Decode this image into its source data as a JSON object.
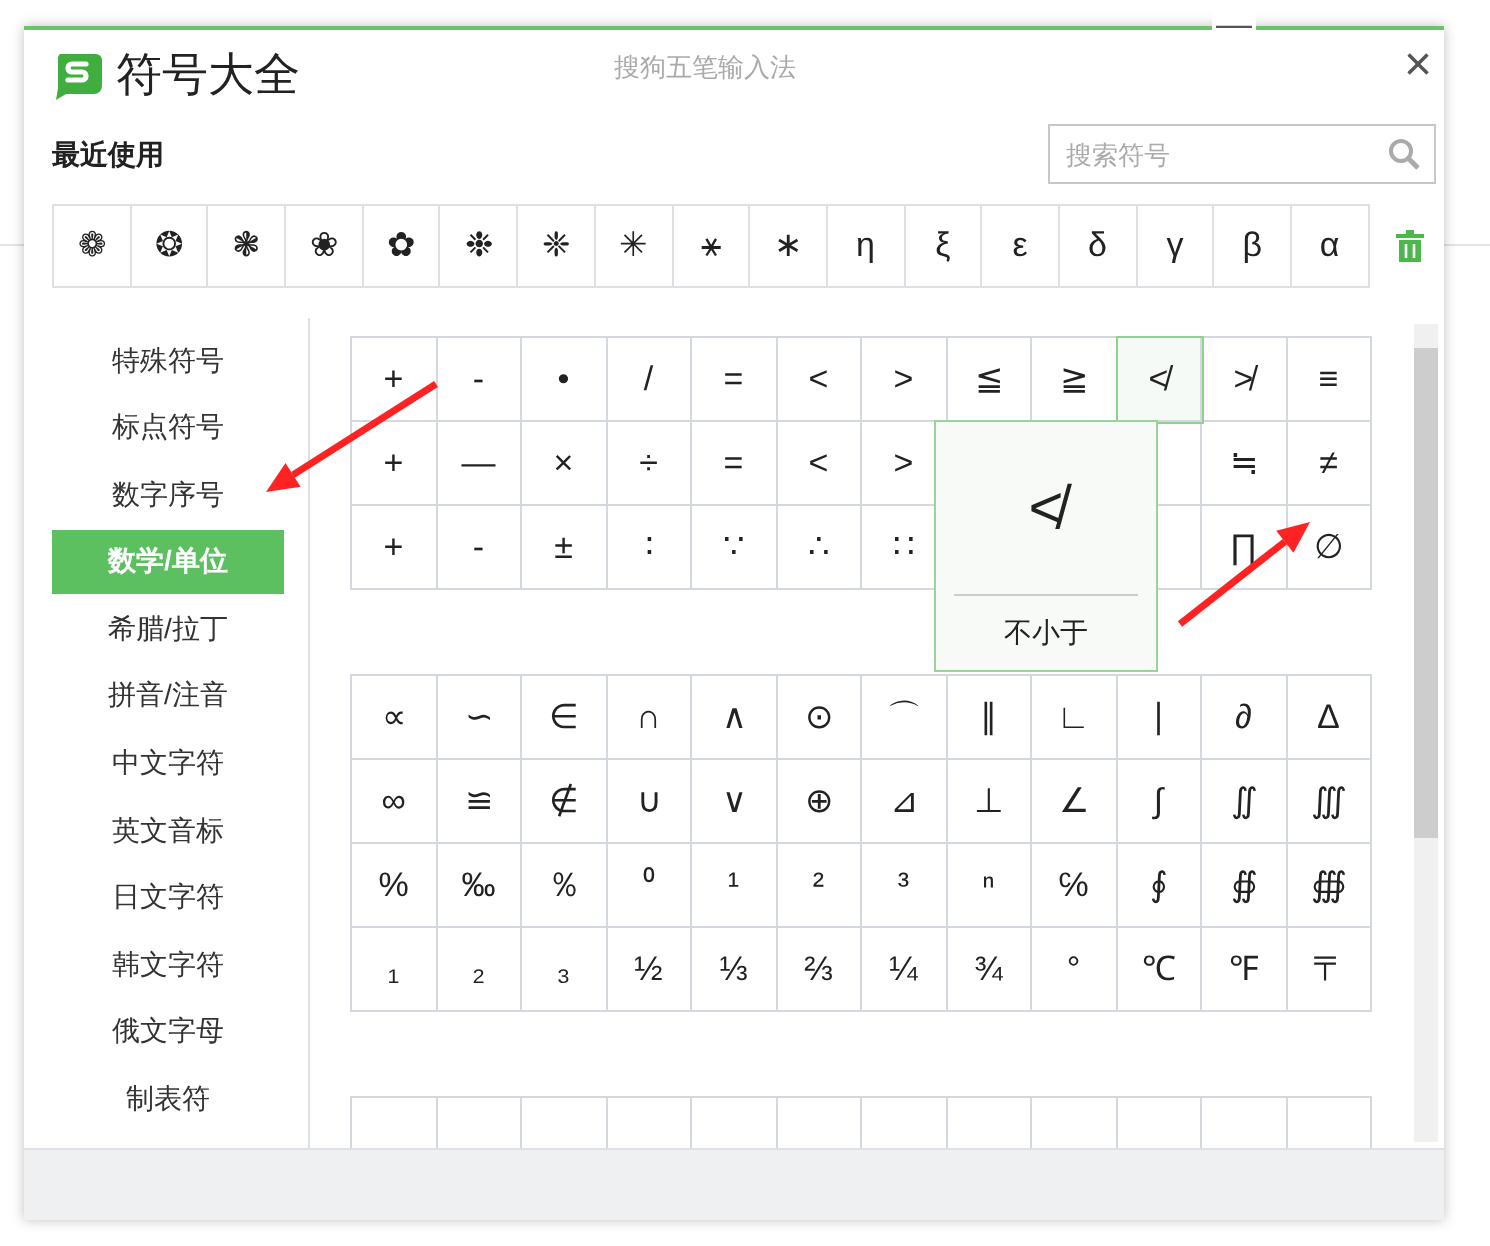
{
  "window": {
    "title": "符号大全",
    "subtitle": "搜狗五笔输入法",
    "close": "×",
    "minimize": "—"
  },
  "recent": {
    "label": "最近使用",
    "symbols": [
      "❁",
      "❂",
      "❃",
      "❀",
      "✿",
      "❉",
      "❈",
      "✳",
      "⚹",
      "∗",
      "η",
      "ξ",
      "ε",
      "δ",
      "γ",
      "β",
      "α"
    ]
  },
  "search": {
    "placeholder": "搜索符号"
  },
  "sidebar": {
    "items": [
      {
        "label": "特殊符号",
        "selected": false
      },
      {
        "label": "标点符号",
        "selected": false
      },
      {
        "label": "数字序号",
        "selected": false
      },
      {
        "label": "数学/单位",
        "selected": true
      },
      {
        "label": "希腊/拉丁",
        "selected": false
      },
      {
        "label": "拼音/注音",
        "selected": false
      },
      {
        "label": "中文字符",
        "selected": false
      },
      {
        "label": "英文音标",
        "selected": false
      },
      {
        "label": "日文字符",
        "selected": false
      },
      {
        "label": "韩文字符",
        "selected": false
      },
      {
        "label": "俄文字母",
        "selected": false
      },
      {
        "label": "制表符",
        "selected": false
      }
    ]
  },
  "grids": [
    {
      "rows": [
        [
          {
            "symbol": "+",
            "selected": false
          },
          {
            "symbol": "-",
            "selected": false
          },
          {
            "symbol": "•",
            "selected": false
          },
          {
            "symbol": "/",
            "selected": false
          },
          {
            "symbol": "=",
            "selected": false
          },
          {
            "symbol": "<",
            "selected": false
          },
          {
            "symbol": ">",
            "selected": false
          },
          {
            "symbol": "≦",
            "selected": false
          },
          {
            "symbol": "≧",
            "selected": false
          },
          {
            "symbol": "≮",
            "selected": true
          },
          {
            "symbol": "≯",
            "selected": false
          },
          {
            "symbol": "≡",
            "selected": false
          }
        ],
        [
          {
            "symbol": "+",
            "selected": false
          },
          {
            "symbol": "—",
            "selected": false
          },
          {
            "symbol": "×",
            "selected": false
          },
          {
            "symbol": "÷",
            "selected": false
          },
          {
            "symbol": "=",
            "selected": false
          },
          {
            "symbol": "<",
            "selected": false
          },
          {
            "symbol": ">",
            "selected": false
          },
          null,
          null,
          {
            "selected": false
          },
          {
            "symbol": "≒",
            "selected": false
          },
          {
            "symbol": "≠",
            "selected": false
          }
        ],
        [
          {
            "symbol": "+",
            "selected": false
          },
          {
            "symbol": "-",
            "selected": false
          },
          {
            "symbol": "±",
            "selected": false
          },
          {
            "symbol": "∶",
            "selected": false
          },
          {
            "symbol": "∵",
            "selected": false
          },
          {
            "symbol": "∴",
            "selected": false
          },
          {
            "symbol": "∷",
            "selected": false
          },
          null,
          null,
          {
            "selected": false
          },
          {
            "symbol": "∏",
            "selected": false
          },
          {
            "symbol": "∅",
            "selected": false
          }
        ]
      ],
      "tooltip": {
        "symbol": "≮",
        "name": "不小于"
      }
    },
    {
      "rows": [
        [
          "∝",
          "∽",
          "∈",
          "∩",
          "∧",
          "⊙",
          "⌒",
          "∥",
          "∟",
          "∣",
          "∂",
          "∆"
        ],
        [
          "∞",
          "≌",
          "∉",
          "∪",
          "∨",
          "⊕",
          "⊿",
          "⊥",
          "∠",
          "∫",
          "∬",
          "∭"
        ],
        [
          "%",
          "‰",
          "％",
          "⁰",
          "¹",
          "²",
          "³",
          "ⁿ",
          "℅",
          "∮",
          "∯",
          "∰"
        ],
        [
          "₁",
          "₂",
          "₃",
          "½",
          "⅓",
          "⅔",
          "¼",
          "¾",
          "°",
          "℃",
          "℉",
          "〒"
        ]
      ]
    }
  ]
}
